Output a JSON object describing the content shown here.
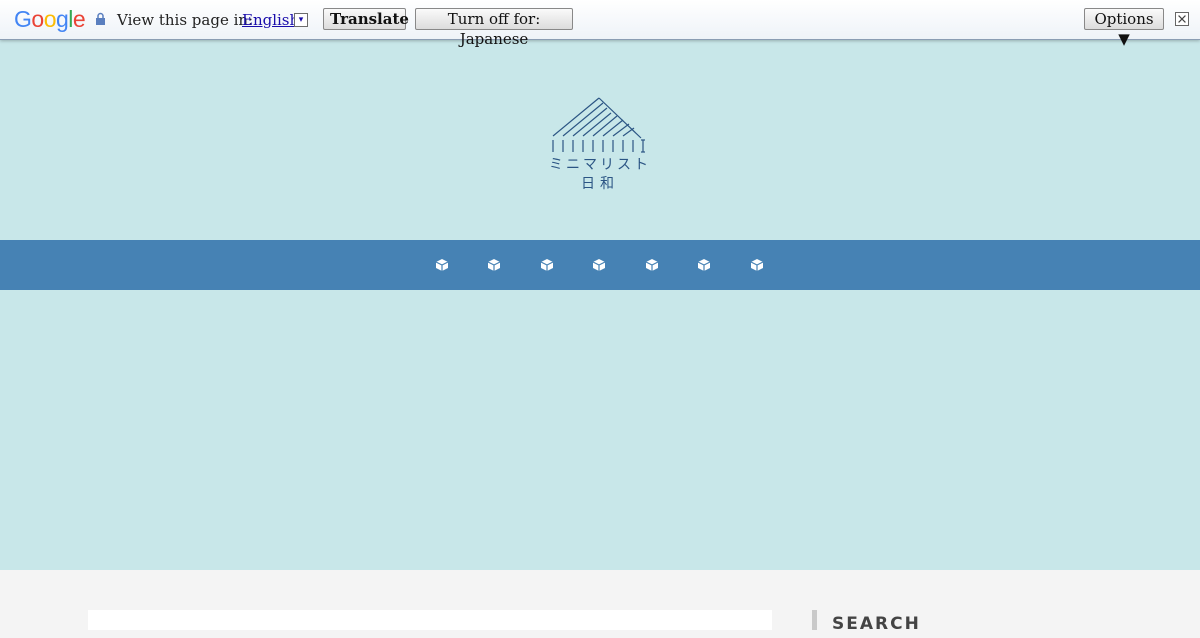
{
  "translate_bar": {
    "logo": [
      "G",
      "o",
      "o",
      "g",
      "l",
      "e"
    ],
    "logo_colors": [
      "#4285f4",
      "#ea4335",
      "#fbbc05",
      "#4285f4",
      "#34a853",
      "#ea4335"
    ],
    "view_label": "View this page in:",
    "language": "English",
    "dropdown_glyph": "▾",
    "translate_label": "Translate",
    "turnoff_label": "Turn off for: Japanese",
    "options_label": "Options ▼"
  },
  "site": {
    "logo_line1": "ミニマリスト",
    "logo_line2": "日和",
    "logo_color": "#2b5584",
    "header_bg": "#c8e7e9",
    "nav_bg": "#4682b4"
  },
  "nav": {
    "items": [
      "cube-icon",
      "cube-icon",
      "cube-icon",
      "cube-icon",
      "cube-icon",
      "cube-icon",
      "cube-icon"
    ]
  },
  "sidebar": {
    "search_title": "SEARCH"
  }
}
